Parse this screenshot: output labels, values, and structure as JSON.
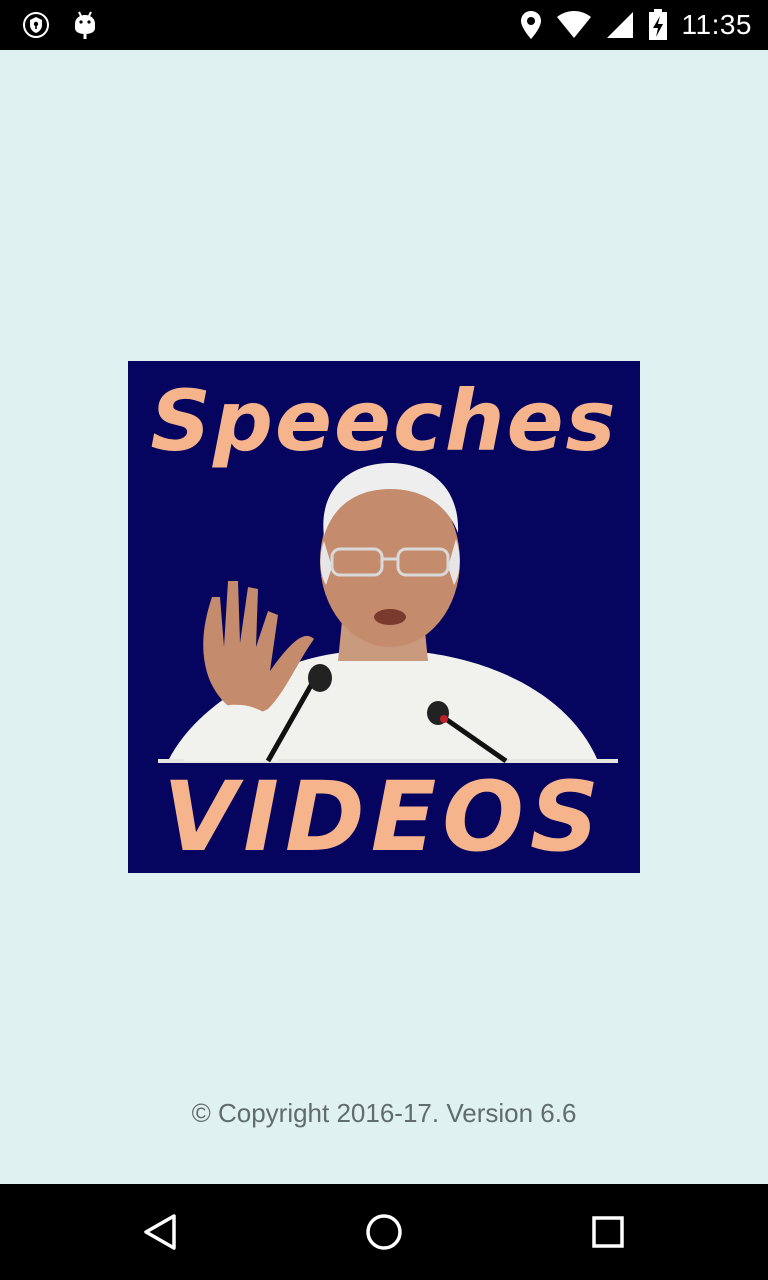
{
  "status_bar": {
    "time": "11:35",
    "left_icons": [
      "shield-icon",
      "android-debug-icon"
    ],
    "right_icons": [
      "location-icon",
      "wifi-icon",
      "signal-icon",
      "battery-charging-icon"
    ]
  },
  "splash": {
    "title_top": "Speeches",
    "title_bottom": "VIDEOS",
    "background_color": "#05045e",
    "text_color": "#f6b48c"
  },
  "footer": {
    "copyright": "© Copyright 2016-17. Version 6.6"
  },
  "nav_bar": {
    "buttons": [
      "back-icon",
      "home-icon",
      "recents-icon"
    ]
  },
  "colors": {
    "screen_background": "#e0f1f1",
    "system_bars": "#000000"
  }
}
